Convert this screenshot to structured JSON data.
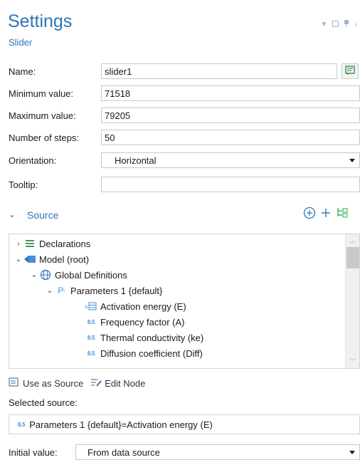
{
  "header": {
    "title": "Settings",
    "subtitle": "Slider"
  },
  "form": {
    "name": {
      "label": "Name:",
      "value": "slider1"
    },
    "min": {
      "label": "Minimum value:",
      "value": "71518"
    },
    "max": {
      "label": "Maximum value:",
      "value": "79205"
    },
    "steps": {
      "label": "Number of steps:",
      "value": "50"
    },
    "orientation": {
      "label": "Orientation:",
      "value": "Horizontal"
    },
    "tooltip": {
      "label": "Tooltip:",
      "value": ""
    }
  },
  "source_section": {
    "label": "Source",
    "tree": [
      {
        "text": "Declarations"
      },
      {
        "text": "Model (root)"
      },
      {
        "text": "Global Definitions"
      },
      {
        "text": "Parameters 1 {default}"
      },
      {
        "text": "Activation energy (E)"
      },
      {
        "text": "Frequency factor (A)"
      },
      {
        "text": "Thermal conductivity (ke)"
      },
      {
        "text": "Diffusion coefficient (Diff)"
      }
    ],
    "actions": {
      "use_as_source": "Use as Source",
      "edit_node": "Edit Node"
    },
    "selected_label": "Selected source:",
    "selected_value": "Parameters 1 {default}=Activation energy (E)"
  },
  "initial": {
    "label": "Initial value:",
    "value": "From data source"
  },
  "colors": {
    "accent": "#2e75b6",
    "border": "#c8c8c8",
    "param_badge": "#4a8fd6"
  }
}
